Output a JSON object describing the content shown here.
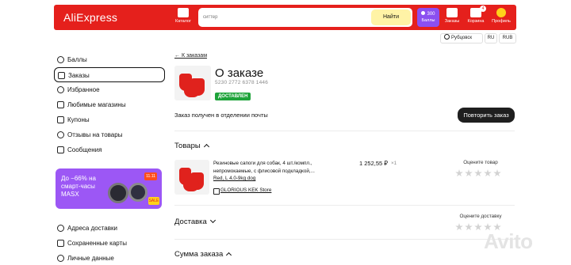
{
  "header": {
    "logo": "AliExpress",
    "catalog_label": "Каталог",
    "search_placeholder": "ситтер",
    "search_button": "Найти",
    "points_value": "300",
    "points_label": "Баллы",
    "orders_label": "Заказы",
    "cart_label": "Корзина",
    "cart_count": "4",
    "profile_label": "Профиль",
    "brand_color": "#e5201c"
  },
  "locale": {
    "city": "Рубцовск",
    "language": "RU",
    "currency": "RUB"
  },
  "sidebar": {
    "items": [
      {
        "label": "Баллы",
        "icon": "points-icon"
      },
      {
        "label": "Заказы",
        "icon": "orders-icon",
        "active": true
      },
      {
        "label": "Избранное",
        "icon": "heart-icon"
      },
      {
        "label": "Любимые магазины",
        "icon": "store-icon"
      },
      {
        "label": "Купоны",
        "icon": "coupon-icon"
      },
      {
        "label": "Отзывы на товары",
        "icon": "review-icon"
      },
      {
        "label": "Сообщения",
        "icon": "message-icon"
      },
      {
        "label": "Адреса доставки",
        "icon": "location-icon"
      },
      {
        "label": "Сохраненные карты",
        "icon": "card-icon"
      },
      {
        "label": "Личные данные",
        "icon": "person-icon"
      }
    ],
    "promo": {
      "line1": "До −66% на",
      "line2": "смарт-часы",
      "line3": "MASX",
      "badge": "11.11",
      "sale": "SALE"
    }
  },
  "order": {
    "back_link": "← К заказам",
    "title": "О заказе",
    "number": "5230 2772 6378 1446",
    "status_badge": "ДОСТАВЛЕН",
    "status_text": "Заказ получен в отделении почты",
    "repeat_button": "Повторить заказ"
  },
  "products_section": {
    "title": "Товары",
    "items": [
      {
        "name": "Резиновые сапоги для собак, 4 шт./компл., непромокаемые, с флисовой подкладкой,...",
        "variant": "Red, L 4.0-9kg dog",
        "store": "GLORIOUS KEK Store",
        "price": "1 252,55 ₽",
        "quantity": "×1",
        "rate_label": "Оцените товар",
        "rating": 0
      }
    ]
  },
  "delivery_section": {
    "title": "Доставка",
    "rate_label": "Оцените доставку",
    "rating": 0
  },
  "sum_section": {
    "title": "Сумма заказа"
  },
  "watermark": "Avito"
}
